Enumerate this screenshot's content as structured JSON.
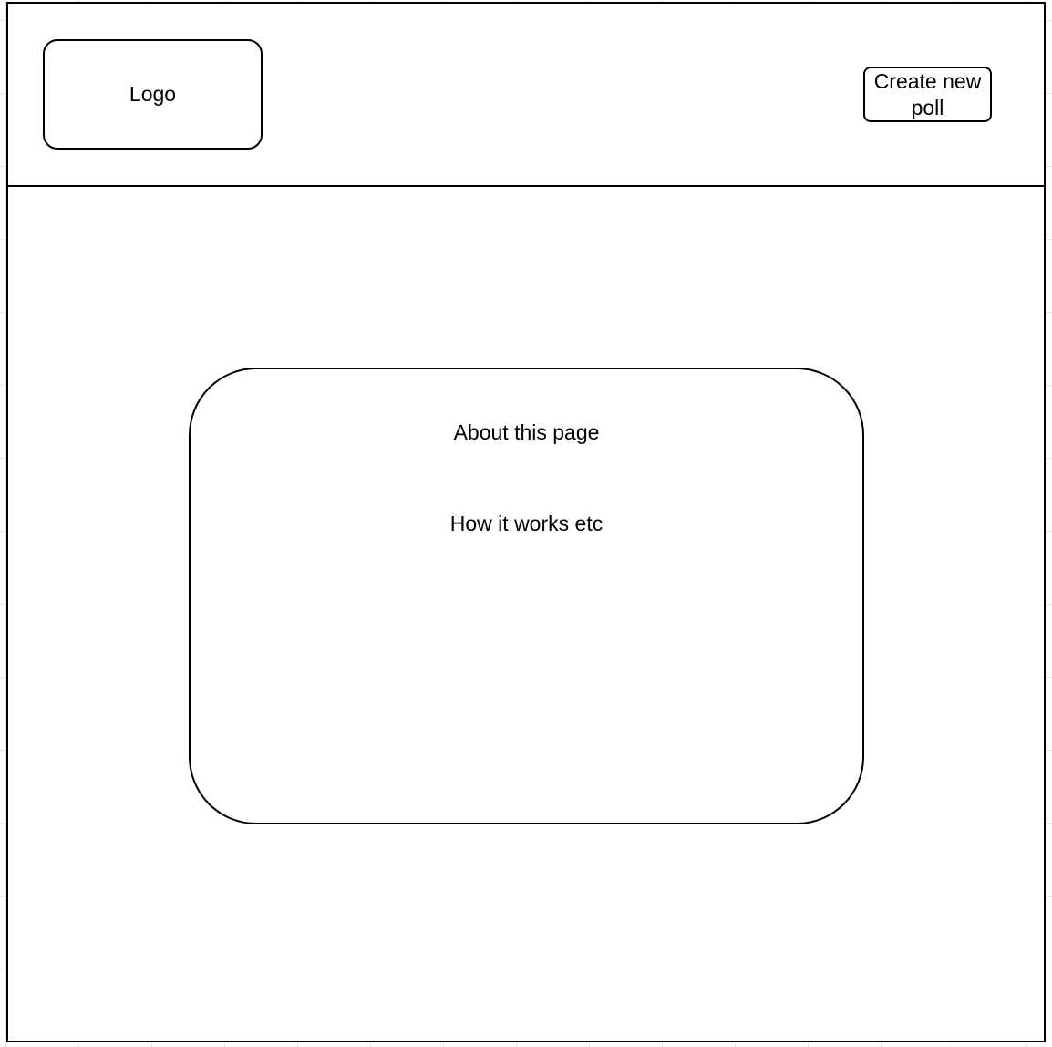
{
  "header": {
    "logo_text": "Logo",
    "create_poll_label": "Create new poll"
  },
  "main": {
    "about_title": "About this page",
    "about_body": "How it works etc"
  }
}
